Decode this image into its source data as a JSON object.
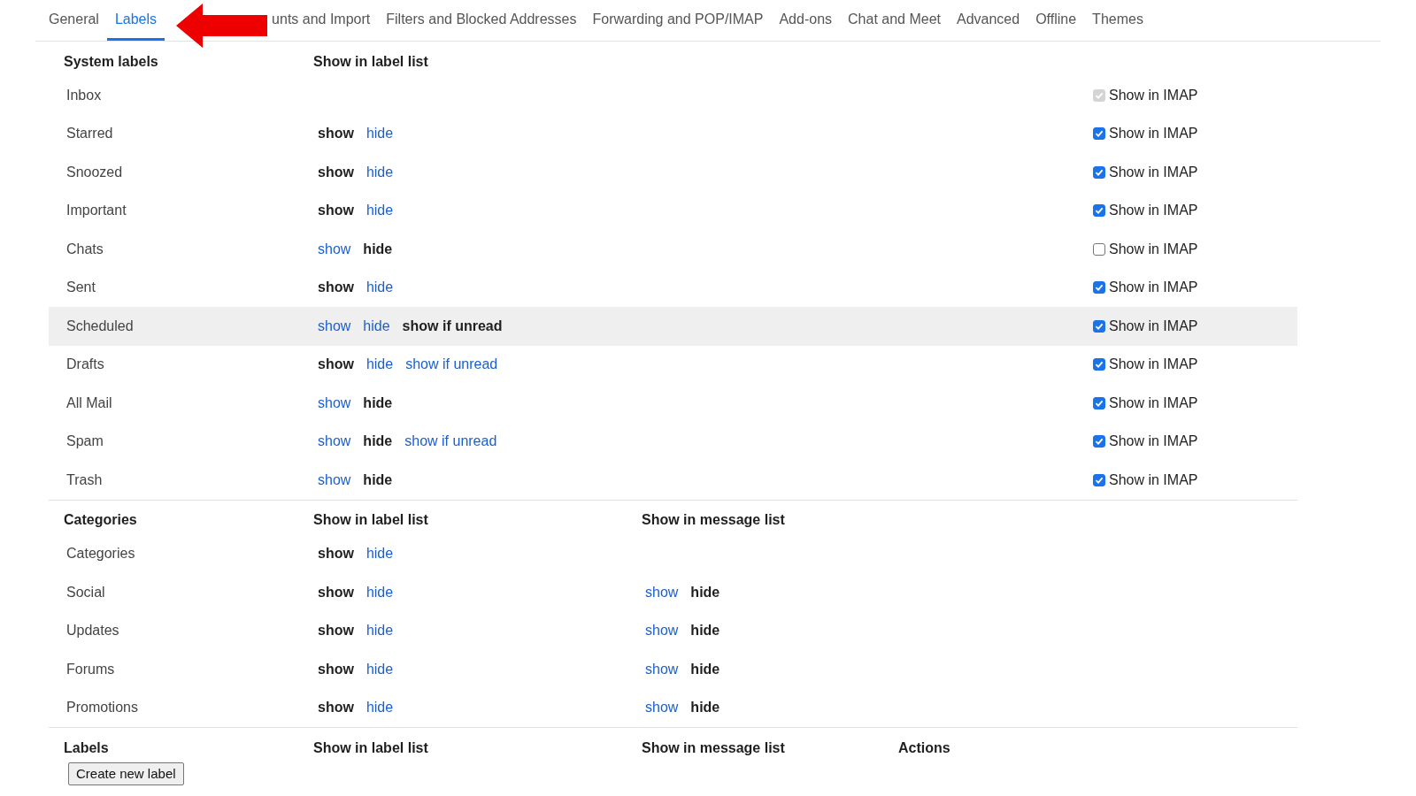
{
  "tabs": [
    {
      "label": "General",
      "selected": false
    },
    {
      "label": "Labels",
      "selected": true
    },
    {
      "label": "unts and Import",
      "selected": false
    },
    {
      "label": "Filters and Blocked Addresses",
      "selected": false
    },
    {
      "label": "Forwarding and POP/IMAP",
      "selected": false
    },
    {
      "label": "Add-ons",
      "selected": false
    },
    {
      "label": "Chat and Meet",
      "selected": false
    },
    {
      "label": "Advanced",
      "selected": false
    },
    {
      "label": "Offline",
      "selected": false
    },
    {
      "label": "Themes",
      "selected": false
    }
  ],
  "system_labels": {
    "heading": "System labels",
    "label_list_heading": "Show in label list",
    "rows": [
      {
        "name": "Inbox",
        "highlighted": false,
        "label_list": [],
        "imap": {
          "label": "Show in IMAP",
          "checked": true,
          "disabled": true
        }
      },
      {
        "name": "Starred",
        "highlighted": false,
        "label_list": [
          {
            "label": "show",
            "selected": true
          },
          {
            "label": "hide",
            "selected": false
          }
        ],
        "imap": {
          "label": "Show in IMAP",
          "checked": true,
          "disabled": false
        }
      },
      {
        "name": "Snoozed",
        "highlighted": false,
        "label_list": [
          {
            "label": "show",
            "selected": true
          },
          {
            "label": "hide",
            "selected": false
          }
        ],
        "imap": {
          "label": "Show in IMAP",
          "checked": true,
          "disabled": false
        }
      },
      {
        "name": "Important",
        "highlighted": false,
        "label_list": [
          {
            "label": "show",
            "selected": true
          },
          {
            "label": "hide",
            "selected": false
          }
        ],
        "imap": {
          "label": "Show in IMAP",
          "checked": true,
          "disabled": false
        }
      },
      {
        "name": "Chats",
        "highlighted": false,
        "label_list": [
          {
            "label": "show",
            "selected": false
          },
          {
            "label": "hide",
            "selected": true
          }
        ],
        "imap": {
          "label": "Show in IMAP",
          "checked": false,
          "disabled": false
        }
      },
      {
        "name": "Sent",
        "highlighted": false,
        "label_list": [
          {
            "label": "show",
            "selected": true
          },
          {
            "label": "hide",
            "selected": false
          }
        ],
        "imap": {
          "label": "Show in IMAP",
          "checked": true,
          "disabled": false
        }
      },
      {
        "name": "Scheduled",
        "highlighted": true,
        "label_list": [
          {
            "label": "show",
            "selected": false
          },
          {
            "label": "hide",
            "selected": false
          },
          {
            "label": "show if unread",
            "selected": true
          }
        ],
        "imap": {
          "label": "Show in IMAP",
          "checked": true,
          "disabled": false
        }
      },
      {
        "name": "Drafts",
        "highlighted": false,
        "label_list": [
          {
            "label": "show",
            "selected": true
          },
          {
            "label": "hide",
            "selected": false
          },
          {
            "label": "show if unread",
            "selected": false
          }
        ],
        "imap": {
          "label": "Show in IMAP",
          "checked": true,
          "disabled": false
        }
      },
      {
        "name": "All Mail",
        "highlighted": false,
        "label_list": [
          {
            "label": "show",
            "selected": false
          },
          {
            "label": "hide",
            "selected": true
          }
        ],
        "imap": {
          "label": "Show in IMAP",
          "checked": true,
          "disabled": false
        }
      },
      {
        "name": "Spam",
        "highlighted": false,
        "label_list": [
          {
            "label": "show",
            "selected": false
          },
          {
            "label": "hide",
            "selected": true
          },
          {
            "label": "show if unread",
            "selected": false
          }
        ],
        "imap": {
          "label": "Show in IMAP",
          "checked": true,
          "disabled": false
        }
      },
      {
        "name": "Trash",
        "highlighted": false,
        "label_list": [
          {
            "label": "show",
            "selected": false
          },
          {
            "label": "hide",
            "selected": true
          }
        ],
        "imap": {
          "label": "Show in IMAP",
          "checked": true,
          "disabled": false
        }
      }
    ]
  },
  "categories": {
    "heading": "Categories",
    "label_list_heading": "Show in label list",
    "message_list_heading": "Show in message list",
    "rows": [
      {
        "name": "Categories",
        "label_list": [
          {
            "label": "show",
            "selected": true
          },
          {
            "label": "hide",
            "selected": false
          }
        ],
        "message_list": []
      },
      {
        "name": "Social",
        "label_list": [
          {
            "label": "show",
            "selected": true
          },
          {
            "label": "hide",
            "selected": false
          }
        ],
        "message_list": [
          {
            "label": "show",
            "selected": false
          },
          {
            "label": "hide",
            "selected": true
          }
        ]
      },
      {
        "name": "Updates",
        "label_list": [
          {
            "label": "show",
            "selected": true
          },
          {
            "label": "hide",
            "selected": false
          }
        ],
        "message_list": [
          {
            "label": "show",
            "selected": false
          },
          {
            "label": "hide",
            "selected": true
          }
        ]
      },
      {
        "name": "Forums",
        "label_list": [
          {
            "label": "show",
            "selected": true
          },
          {
            "label": "hide",
            "selected": false
          }
        ],
        "message_list": [
          {
            "label": "show",
            "selected": false
          },
          {
            "label": "hide",
            "selected": true
          }
        ]
      },
      {
        "name": "Promotions",
        "label_list": [
          {
            "label": "show",
            "selected": true
          },
          {
            "label": "hide",
            "selected": false
          }
        ],
        "message_list": [
          {
            "label": "show",
            "selected": false
          },
          {
            "label": "hide",
            "selected": true
          }
        ]
      }
    ]
  },
  "labels": {
    "heading": "Labels",
    "label_list_heading": "Show in label list",
    "message_list_heading": "Show in message list",
    "actions_heading": "Actions",
    "create_button": "Create new label"
  }
}
